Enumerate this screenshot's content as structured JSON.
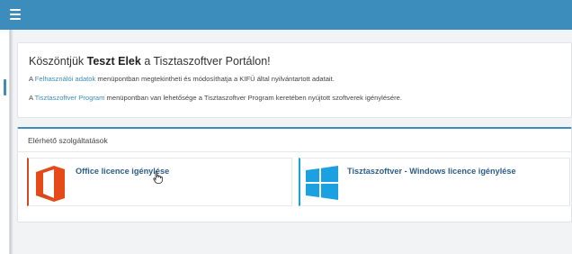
{
  "topbar": {
    "menu_icon": "hamburger-icon",
    "color": "#3c8dbc"
  },
  "welcome": {
    "greeting_prefix": "Köszöntjük ",
    "user_name": "Teszt Elek",
    "greeting_suffix": " a Tisztaszoftver Portálon!",
    "line1_prefix": "A ",
    "line1_link": "Felhasználói adatok",
    "line1_suffix": " menüpontban megtekintheti és módosíthatja a KIFÜ által nyilvántartott adatait.",
    "line2_prefix": "A ",
    "line2_link": "Tisztaszoftver Program",
    "line2_suffix": " menüpontban van lehetősége a Tisztaszoftver Program keretében nyújtott szoftverek igénylésére."
  },
  "services": {
    "title": "Elérhető szolgáltatások",
    "cards": [
      {
        "label": "Office licence igénylése",
        "icon": "office-icon",
        "accent": "#d24726"
      },
      {
        "label": "Tisztaszoftver - Windows licence igénylése",
        "icon": "windows-icon",
        "accent": "#1ba1e2"
      }
    ]
  }
}
